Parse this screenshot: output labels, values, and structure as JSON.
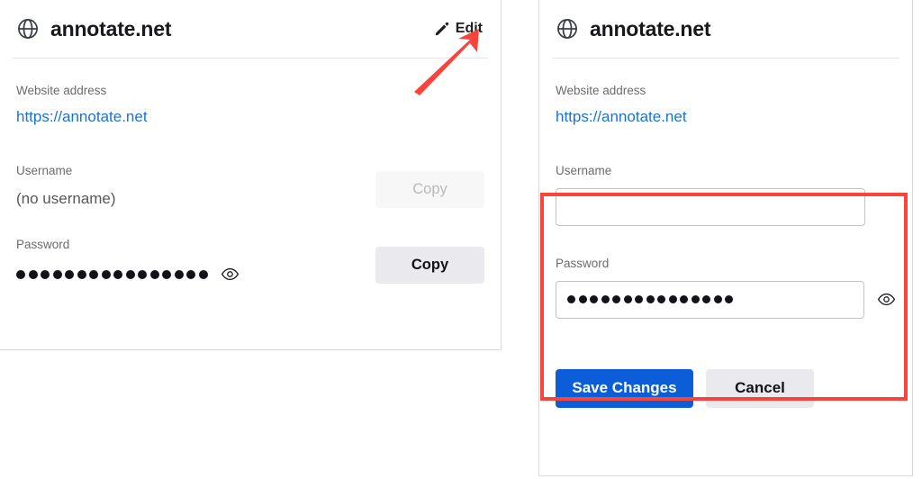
{
  "view_card": {
    "header": {
      "icon": "globe-icon",
      "title": "annotate.net",
      "edit_label": "Edit",
      "edit_icon": "pencil-icon"
    },
    "website": {
      "label": "Website address",
      "value": "https://annotate.net"
    },
    "username": {
      "label": "Username",
      "value": "(no username)",
      "copy_label": "Copy",
      "copy_disabled": true
    },
    "password": {
      "label": "Password",
      "masked_char_count": 16,
      "copy_label": "Copy",
      "copy_disabled": false,
      "reveal_icon": "eye-icon"
    }
  },
  "edit_card": {
    "header": {
      "icon": "globe-icon",
      "title": "annotate.net"
    },
    "website": {
      "label": "Website address",
      "value": "https://annotate.net"
    },
    "username": {
      "label": "Username",
      "value": "",
      "placeholder": ""
    },
    "password": {
      "label": "Password",
      "masked_char_count": 15,
      "reveal_icon": "eye-icon"
    },
    "actions": {
      "save_label": "Save Changes",
      "cancel_label": "Cancel"
    }
  },
  "annotations": {
    "arrow": {
      "name": "red-arrow-pointing-to-edit",
      "color": "#f9443c",
      "points_to": "Edit"
    },
    "highlight_box": {
      "name": "red-highlight-box-around-credentials",
      "color": "#f9443c",
      "surrounds": "Username and Password fields"
    }
  },
  "colors": {
    "primary_blue": "#0b5ed7",
    "link_blue": "#1a73d4",
    "annotation_red": "#f9443c",
    "button_grey": "#eaeaee"
  }
}
